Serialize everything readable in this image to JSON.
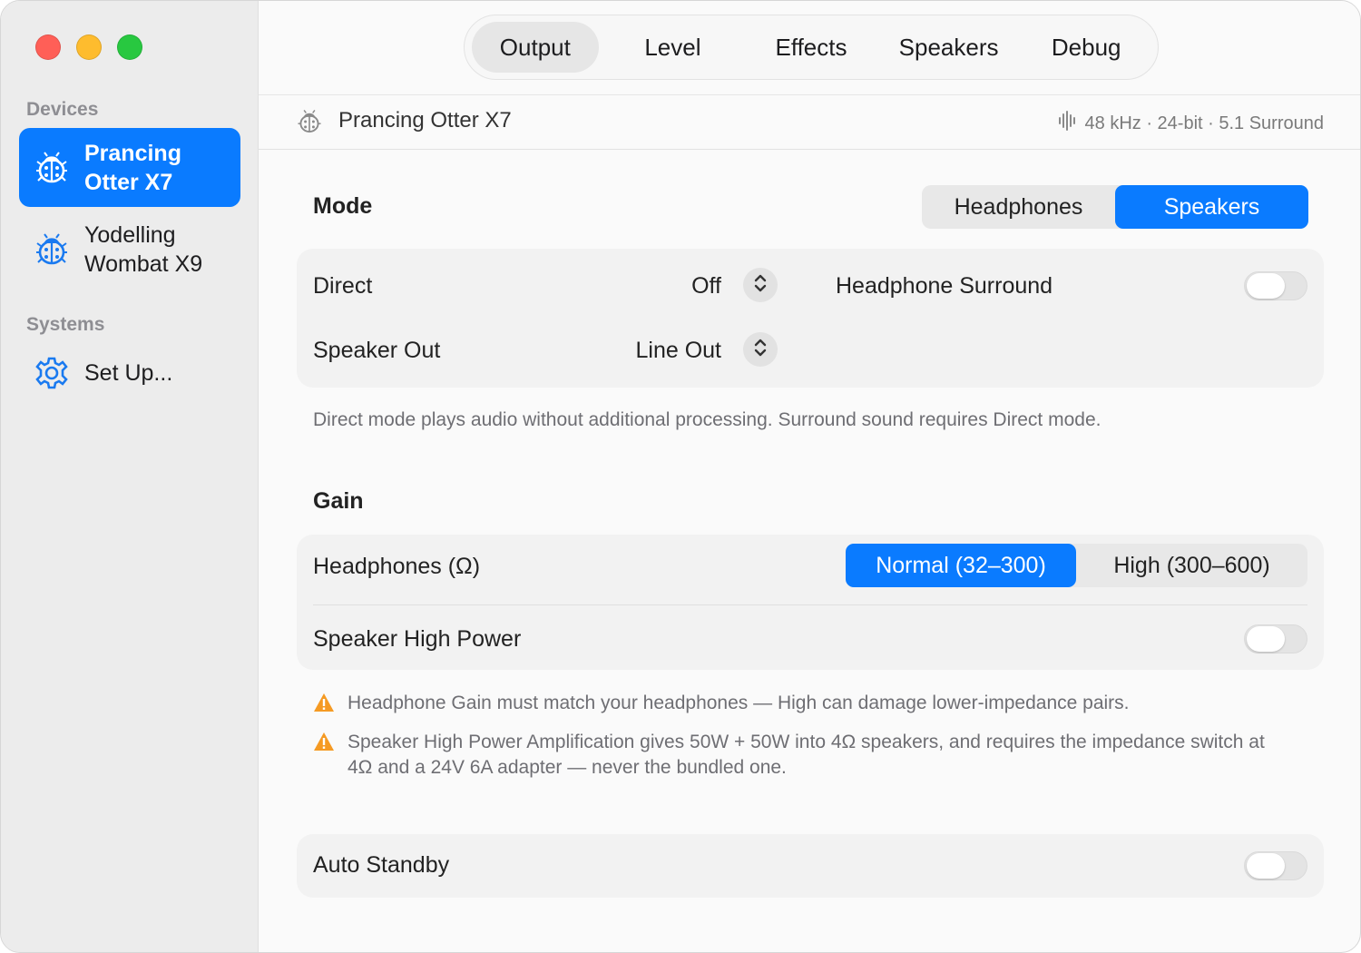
{
  "window": {
    "traffic_lights": [
      "red",
      "yellow",
      "green"
    ]
  },
  "sidebar": {
    "devices_header": "Devices",
    "devices": [
      {
        "label_line1": "Prancing",
        "label_line2": "Otter X7",
        "icon": "ladybug-icon",
        "selected": true
      },
      {
        "label_line1": "Yodelling",
        "label_line2": "Wombat X9",
        "icon": "ladybug-icon",
        "selected": false
      }
    ],
    "systems_header": "Systems",
    "systems": [
      {
        "label": "Set Up...",
        "icon": "gear-icon"
      }
    ]
  },
  "tabs": [
    {
      "label": "Output",
      "active": true
    },
    {
      "label": "Level",
      "active": false
    },
    {
      "label": "Effects",
      "active": false
    },
    {
      "label": "Speakers",
      "active": false
    },
    {
      "label": "Debug",
      "active": false
    }
  ],
  "device_header": {
    "name": "Prancing Otter X7",
    "format": "48 kHz · 24-bit · 5.1 Surround",
    "icon": "ladybug-icon",
    "format_icon": "waveform-icon"
  },
  "mode": {
    "title": "Mode",
    "options": [
      "Headphones",
      "Speakers"
    ],
    "selected": "Speakers",
    "direct_label": "Direct",
    "direct_value": "Off",
    "speaker_out_label": "Speaker Out",
    "speaker_out_value": "Line Out",
    "headphone_surround_label": "Headphone Surround",
    "headphone_surround_on": false,
    "note": "Direct mode plays audio without additional processing. Surround sound requires Direct mode."
  },
  "gain": {
    "title": "Gain",
    "headphones_label": "Headphones (Ω)",
    "headphones_options": [
      "Normal (32–300)",
      "High (300–600)"
    ],
    "headphones_selected": "Normal (32–300)",
    "speaker_high_power_label": "Speaker High Power",
    "speaker_high_power_on": false,
    "warnings": [
      "Headphone Gain must match your headphones — High can damage lower-impedance pairs.",
      "Speaker High Power Amplification gives 50W + 50W into 4Ω speakers, and requires the impedance switch at 4Ω and a 24V 6A adapter — never the bundled one."
    ]
  },
  "standby": {
    "label": "Auto Standby",
    "on": false
  },
  "colors": {
    "accent": "#0a7bff",
    "warning": "#f59a23"
  }
}
